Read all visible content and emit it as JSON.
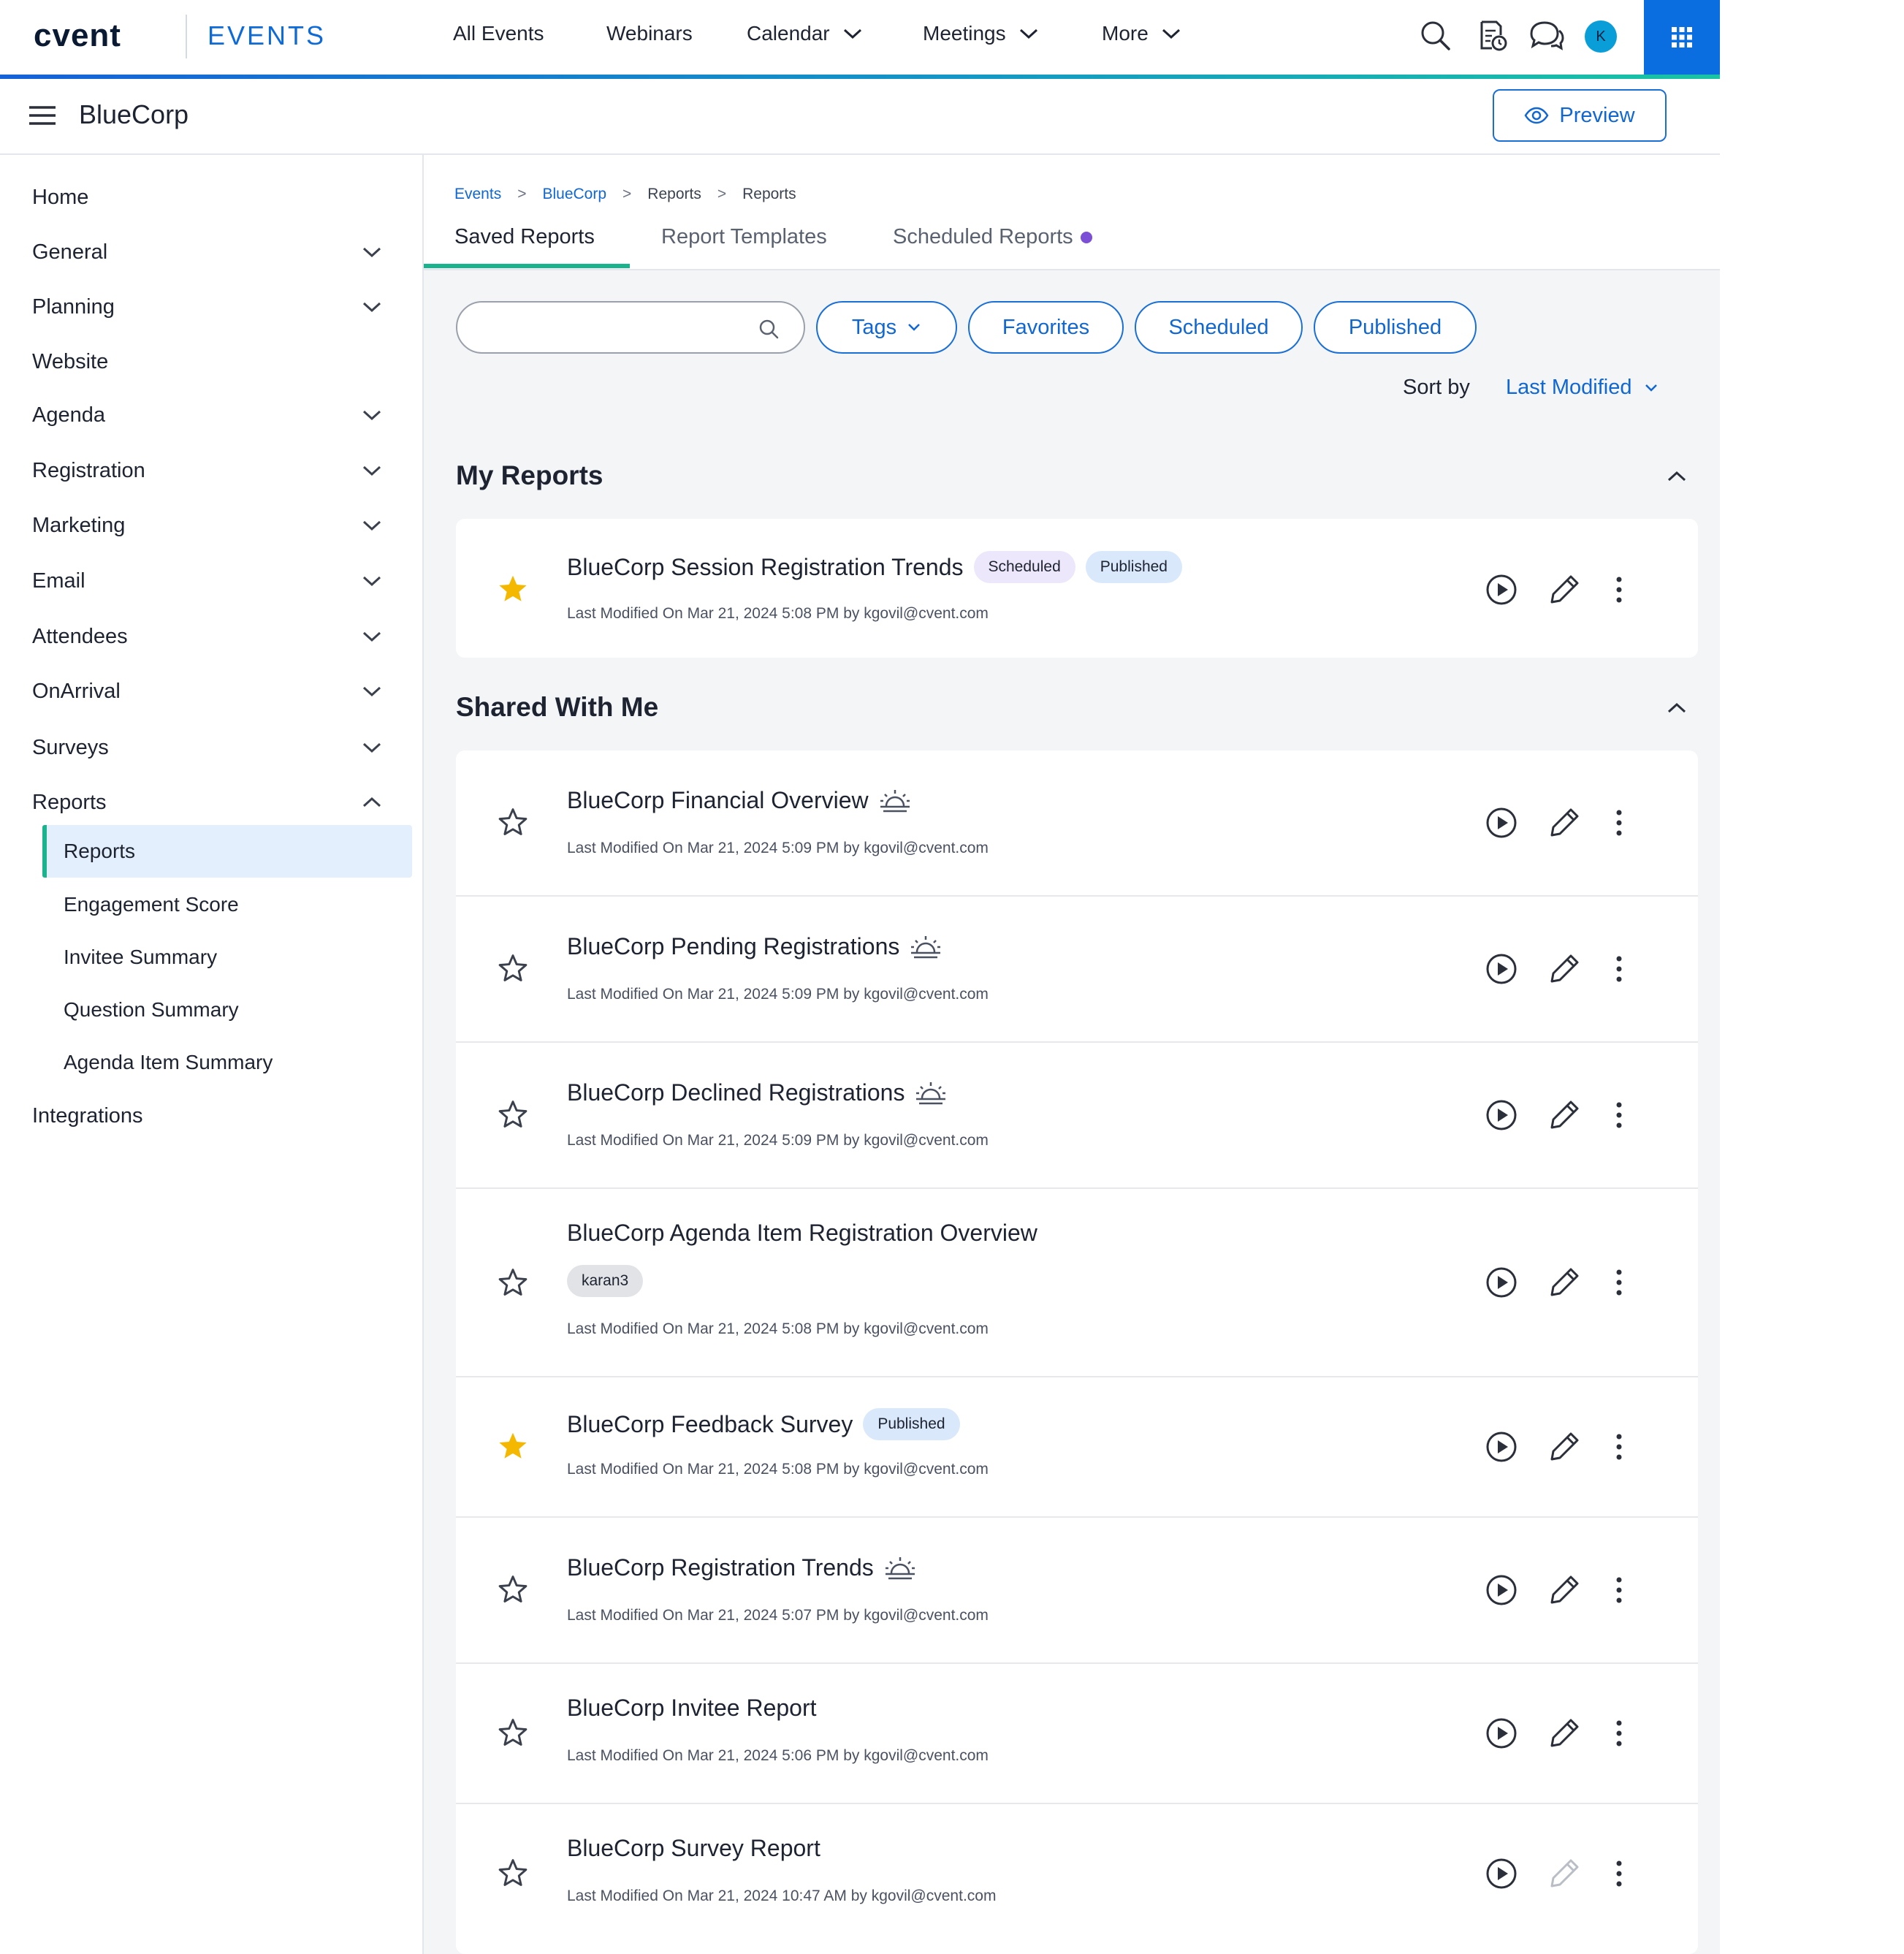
{
  "header": {
    "logo": "cvent",
    "product": "EVENTS",
    "nav": [
      {
        "label": "All Events",
        "dropdown": false
      },
      {
        "label": "Webinars",
        "dropdown": false
      },
      {
        "label": "Calendar",
        "dropdown": true
      },
      {
        "label": "Meetings",
        "dropdown": true
      },
      {
        "label": "More",
        "dropdown": true
      }
    ],
    "icons": [
      "search-icon",
      "report-clock-icon",
      "chat-icon"
    ],
    "avatar_initial": "K",
    "accent_color": "#0a6ee0"
  },
  "subheader": {
    "event_name": "BlueCorp",
    "preview_label": "Preview"
  },
  "sidebar": {
    "items": [
      {
        "label": "Home",
        "expandable": false
      },
      {
        "label": "General",
        "expandable": true
      },
      {
        "label": "Planning",
        "expandable": true
      },
      {
        "label": "Website",
        "expandable": false
      },
      {
        "label": "Agenda",
        "expandable": true
      },
      {
        "label": "Registration",
        "expandable": true
      },
      {
        "label": "Marketing",
        "expandable": true
      },
      {
        "label": "Email",
        "expandable": true
      },
      {
        "label": "Attendees",
        "expandable": true
      },
      {
        "label": "OnArrival",
        "expandable": true
      },
      {
        "label": "Surveys",
        "expandable": true
      },
      {
        "label": "Reports",
        "expandable": true,
        "expanded": true
      }
    ],
    "reports_sub": [
      {
        "label": "Reports",
        "active": true
      },
      {
        "label": "Engagement Score"
      },
      {
        "label": "Invitee Summary"
      },
      {
        "label": "Question Summary"
      },
      {
        "label": "Agenda Item Summary"
      }
    ],
    "after": {
      "label": "Integrations"
    }
  },
  "main": {
    "breadcrumbs": [
      "Events",
      "BlueCorp",
      "Reports",
      "Reports"
    ],
    "tabs": [
      {
        "label": "Saved Reports",
        "active": true
      },
      {
        "label": "Report Templates"
      },
      {
        "label": "Scheduled Reports",
        "indicator_dot": true
      }
    ],
    "search_placeholder": "",
    "filters": {
      "tags": "Tags",
      "favorites": "Favorites",
      "scheduled": "Scheduled",
      "published": "Published"
    },
    "sort": {
      "label": "Sort by",
      "value": "Last Modified"
    },
    "my_reports": {
      "title": "My Reports",
      "rows": [
        {
          "title": "BlueCorp Session Registration Trends",
          "favorite": true,
          "badges": [
            "Scheduled",
            "Published"
          ],
          "meta": "Last Modified On Mar 21, 2024 5:08 PM by kgovil@cvent.com"
        }
      ]
    },
    "shared": {
      "title": "Shared With Me",
      "rows": [
        {
          "title": "BlueCorp Financial Overview",
          "favorite": false,
          "icon": "sunrise-icon",
          "meta": "Last Modified On Mar 21, 2024 5:09 PM by kgovil@cvent.com"
        },
        {
          "title": "BlueCorp Pending Registrations",
          "favorite": false,
          "icon": "sunrise-icon",
          "meta": "Last Modified On Mar 21, 2024 5:09 PM by kgovil@cvent.com"
        },
        {
          "title": "BlueCorp Declined Registrations",
          "favorite": false,
          "icon": "sunrise-icon",
          "meta": "Last Modified On Mar 21, 2024 5:09 PM by kgovil@cvent.com"
        },
        {
          "title": "BlueCorp Agenda Item Registration Overview",
          "favorite": false,
          "tag": "karan3",
          "meta": "Last Modified On Mar 21, 2024 5:08 PM by kgovil@cvent.com"
        },
        {
          "title": "BlueCorp Feedback Survey",
          "favorite": true,
          "badges": [
            "Published"
          ],
          "meta": "Last Modified On Mar 21, 2024 5:08 PM by kgovil@cvent.com"
        },
        {
          "title": "BlueCorp Registration Trends",
          "favorite": false,
          "icon": "sunrise-icon",
          "meta": "Last Modified On Mar 21, 2024 5:07 PM by kgovil@cvent.com"
        },
        {
          "title": "BlueCorp Invitee Report",
          "favorite": false,
          "meta": "Last Modified On Mar 21, 2024 5:06 PM by kgovil@cvent.com"
        },
        {
          "title": "BlueCorp Survey Report",
          "favorite": false,
          "edit_disabled": true,
          "meta": "Last Modified On Mar 21, 2024 10:47 AM by kgovil@cvent.com"
        }
      ]
    },
    "colors": {
      "link": "#1167d2",
      "tab_indicator": "#19b48d",
      "star_filled": "#f5b800",
      "scheduled_badge": "#ece7fb",
      "published_badge": "#d9e8fb"
    }
  }
}
